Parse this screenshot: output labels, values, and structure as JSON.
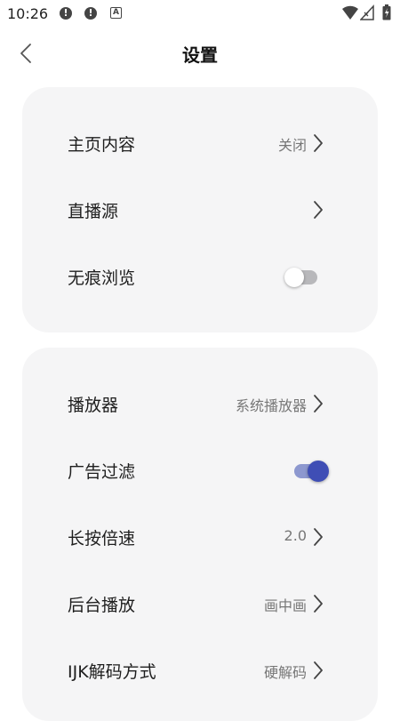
{
  "status_bar": {
    "time": "10:26",
    "notifications": [
      "alert-icon",
      "alert-icon",
      "a-icon"
    ],
    "a_label": "A",
    "system_icons": [
      "wifi-icon",
      "signal-icon",
      "battery-icon"
    ]
  },
  "header": {
    "title": "设置",
    "back_icon": "chevron-left-icon"
  },
  "card1": {
    "home_content": {
      "label": "主页内容",
      "value": "关闭"
    },
    "live_source": {
      "label": "直播源",
      "value": ""
    },
    "incognito": {
      "label": "无痕浏览",
      "toggle_on": false
    }
  },
  "card2": {
    "player": {
      "label": "播放器",
      "value": "系统播放器"
    },
    "ad_filter": {
      "label": "广告过滤",
      "toggle_on": true
    },
    "long_press_speed": {
      "label": "长按倍速",
      "value": "2.0"
    },
    "background_play": {
      "label": "后台播放",
      "value": "画中画"
    },
    "ijk_decode": {
      "label": "IJK解码方式",
      "value": "硬解码"
    }
  },
  "colors": {
    "toggle_on_thumb": "#3f4eb5",
    "toggle_on_track": "#8d98cf",
    "toggle_off_track": "#b8b8bb",
    "card_bg": "#f5f5f6"
  }
}
